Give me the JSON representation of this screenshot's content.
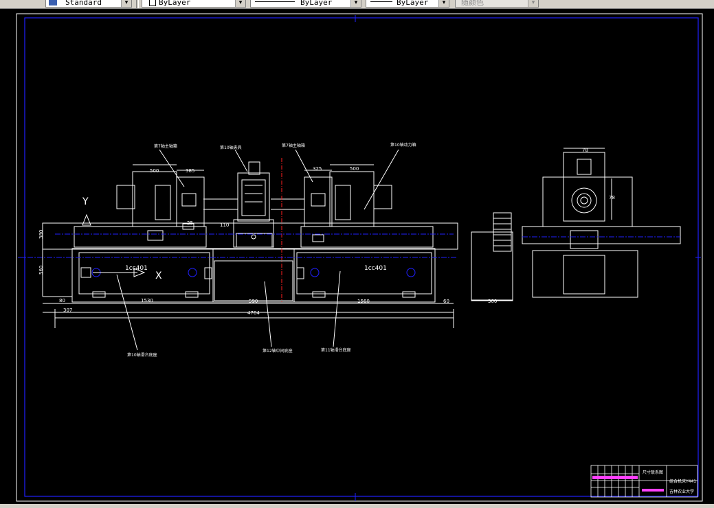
{
  "toolbar": {
    "text_style": "Standard",
    "color": "ByLayer",
    "linetype": "ByLayer",
    "lineweight": "ByLayer",
    "plot_style": "随颜色"
  },
  "drawing": {
    "labels": {
      "top_left_1": "第7轴主轴箱",
      "top_center": "第10轴夹具",
      "top_center_2": "第7轴主轴箱",
      "top_right": "第10轴动力箱",
      "bottom_left": "第10轴滑台底座",
      "bottom_center": "第12轴中间底座",
      "bottom_right": "第11轴滑台底座"
    },
    "dims": {
      "d500_left": "500",
      "d385": "385",
      "d325": "325",
      "d500_right": "500",
      "d25": "25",
      "d110": "110",
      "d380": "380",
      "d560": "560",
      "d80_left": "80",
      "d1530": "1530",
      "d590": "590",
      "d1560": "1560",
      "d60": "60",
      "d307": "307",
      "d4764": "4764",
      "d300": "300",
      "d78_top": "78",
      "d78_side": "78"
    },
    "axis_y": "Y",
    "axis_x": "X",
    "part_left": "1cc401",
    "part_right": "1cc401"
  },
  "title_block": {
    "name": "尺寸联系图",
    "drawing_no": "组合机床Y441",
    "school": "吉林农业大学"
  }
}
